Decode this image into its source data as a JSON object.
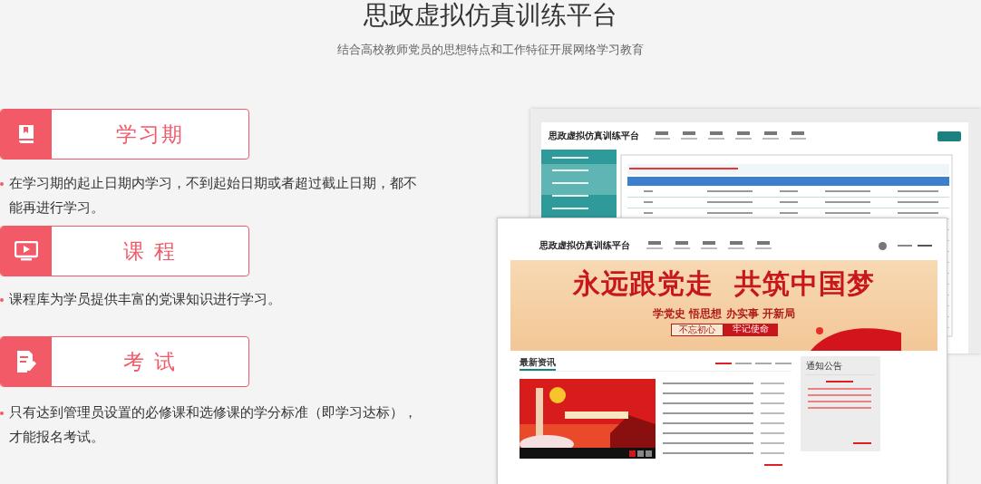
{
  "header": {
    "title": "思政虚拟仿真训练平台",
    "subtitle": "结合高校教师党员的思想特点和工作特征开展网络学习教育"
  },
  "features": [
    {
      "kind": "book",
      "title": "学习期",
      "description": "在学习期的起止日期内学习，不到起始日期或者超过截止日期，都不能再进行学习。"
    },
    {
      "kind": "screen",
      "title": "课 程",
      "description": "课程库为学员提供丰富的党课知识进行学习。"
    },
    {
      "kind": "exam",
      "title": "考 试",
      "description": "只有达到管理员设置的必修课和选修课的学分标准（即学习达标），才能报名考试。"
    }
  ],
  "preview_back": {
    "title": "思政虚拟仿真训练平台"
  },
  "preview_front": {
    "title": "思政虚拟仿真训练平台",
    "banner": {
      "headline": "永远跟党走  共筑中国梦",
      "slogan": "学党史 悟思想 办实事 开新局",
      "tag_left": "不忘初心",
      "tag_right": "牢记使命"
    },
    "news": {
      "heading": "最新资讯",
      "tabs": [
        {
          "selected": true
        },
        {
          "selected": false
        },
        {
          "selected": false
        },
        {
          "selected": false
        }
      ],
      "pages": [
        {
          "selected": true
        },
        {
          "selected": false
        },
        {
          "selected": false
        }
      ]
    },
    "notice": {
      "heading": "通知公告"
    }
  }
}
